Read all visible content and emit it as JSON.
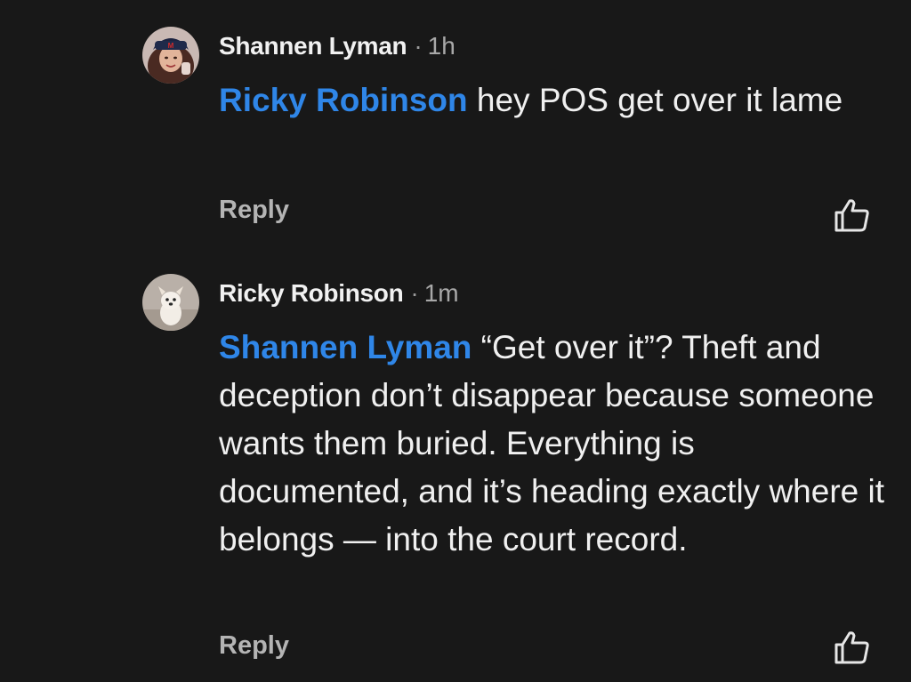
{
  "comments": [
    {
      "author": "Shannen Lyman",
      "separator": "·",
      "time": "1h",
      "mention": "Ricky Robinson",
      "text": " hey POS get over it lame",
      "reply_label": "Reply",
      "avatar_icon": "profile-photo-woman-icon",
      "like_icon": "thumbs-up-icon"
    },
    {
      "author": "Ricky Robinson",
      "separator": "·",
      "time": "1m",
      "mention": "Shannen Lyman",
      "text": " “Get over it”? Theft and deception don’t disappear because someone wants them buried. Everything is documented, and it’s heading exactly where it belongs — into the court record.",
      "reply_label": "Reply",
      "avatar_icon": "profile-photo-dog-icon",
      "like_icon": "thumbs-up-icon"
    }
  ],
  "colors": {
    "background": "#181818",
    "mention": "#2f86e8",
    "text": "#f0f0f0",
    "secondary": "#b4b4b4"
  }
}
